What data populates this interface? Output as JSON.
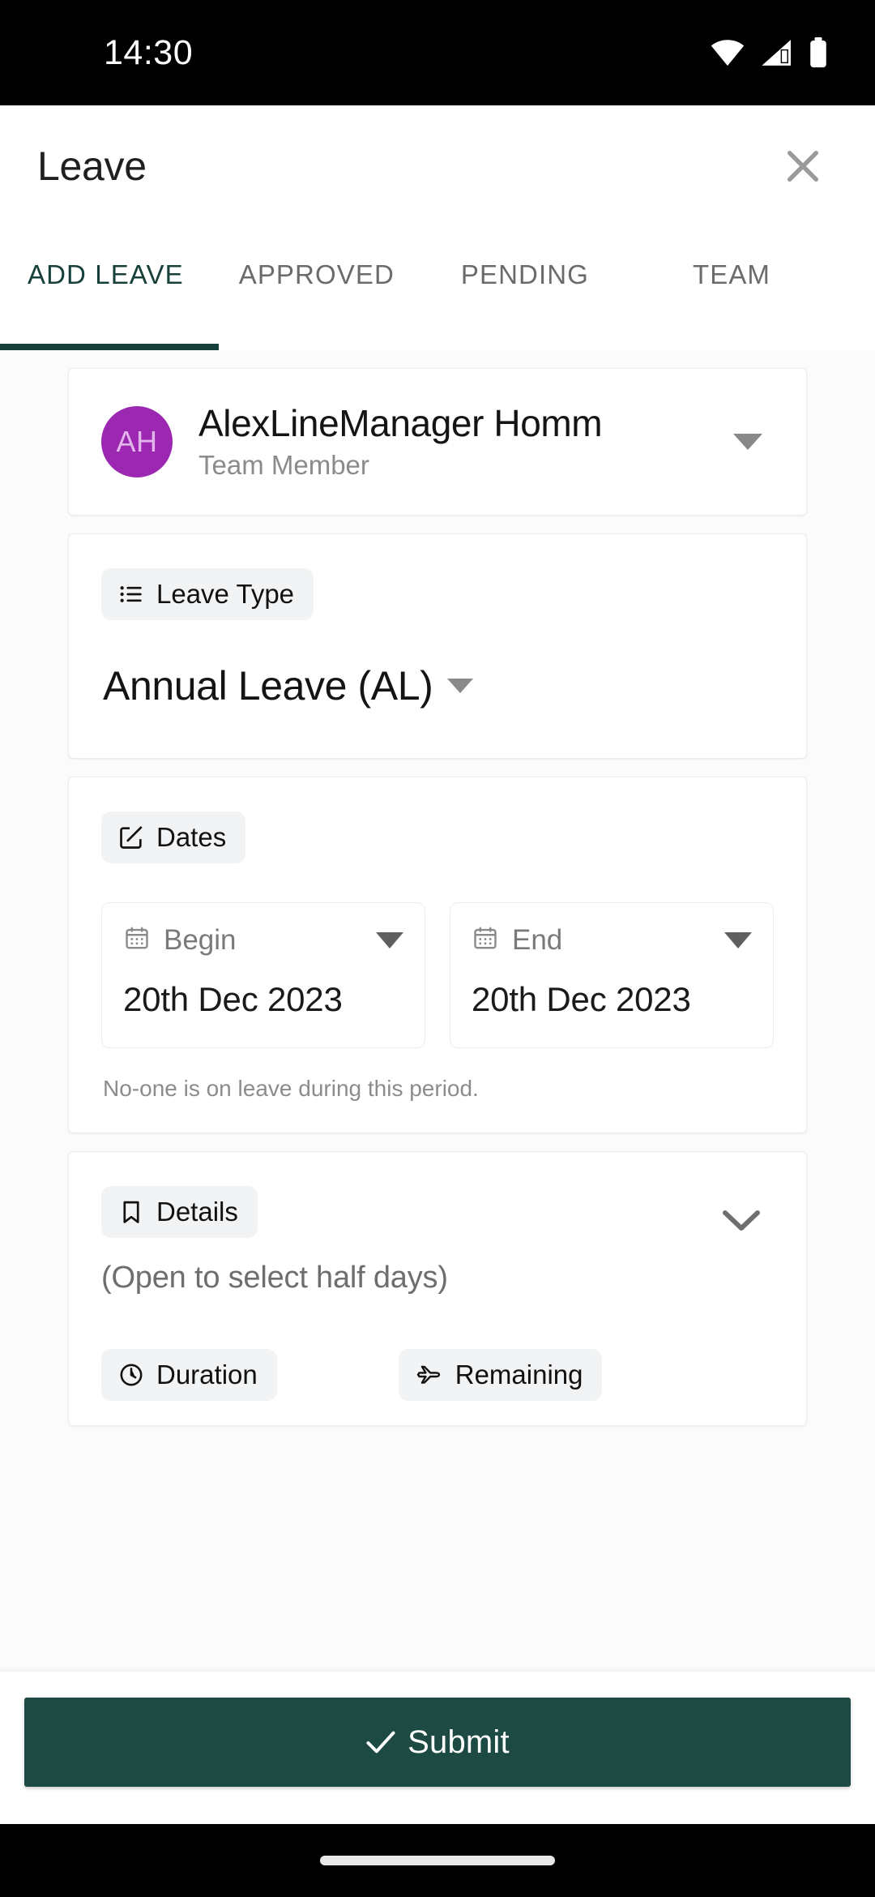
{
  "status_bar": {
    "time": "14:30",
    "icons": [
      "wifi-icon",
      "cellular-signal-icon",
      "battery-icon"
    ]
  },
  "app_bar": {
    "title": "Leave",
    "close_icon": "close-icon"
  },
  "tabs": {
    "active_index": 0,
    "items": [
      {
        "label": "ADD LEAVE"
      },
      {
        "label": "APPROVED"
      },
      {
        "label": "PENDING"
      },
      {
        "label": "TEAM"
      }
    ]
  },
  "user_card": {
    "avatar_initials": "AH",
    "avatar_color": "#9c27b0",
    "name": "AlexLineManager Homm",
    "role": "Team Member",
    "dropdown_icon": "caret-down-icon"
  },
  "leave_type": {
    "chip_label": "Leave Type",
    "chip_icon": "list-icon",
    "value": "Annual Leave (AL)",
    "dropdown_icon": "caret-down-icon"
  },
  "dates": {
    "chip_label": "Dates",
    "chip_icon": "edit-square-icon",
    "begin": {
      "label": "Begin",
      "icon": "calendar-icon",
      "value": "20th Dec 2023",
      "dropdown_icon": "caret-down-icon"
    },
    "end": {
      "label": "End",
      "icon": "calendar-icon",
      "value": "20th Dec 2023",
      "dropdown_icon": "caret-down-icon"
    },
    "note": "No-one is on leave during this period."
  },
  "details": {
    "chip_label": "Details",
    "chip_icon": "bookmark-icon",
    "expand_icon": "chevron-down-icon",
    "hint": "(Open to select half days)",
    "duration_chip": {
      "label": "Duration",
      "icon": "clock-icon"
    },
    "remaining_chip": {
      "label": "Remaining",
      "icon": "airplane-icon"
    }
  },
  "submit": {
    "label": "Submit",
    "icon": "check-icon",
    "color": "#1d4a42"
  },
  "nav_bar": {
    "home_pill": "home-indicator"
  }
}
